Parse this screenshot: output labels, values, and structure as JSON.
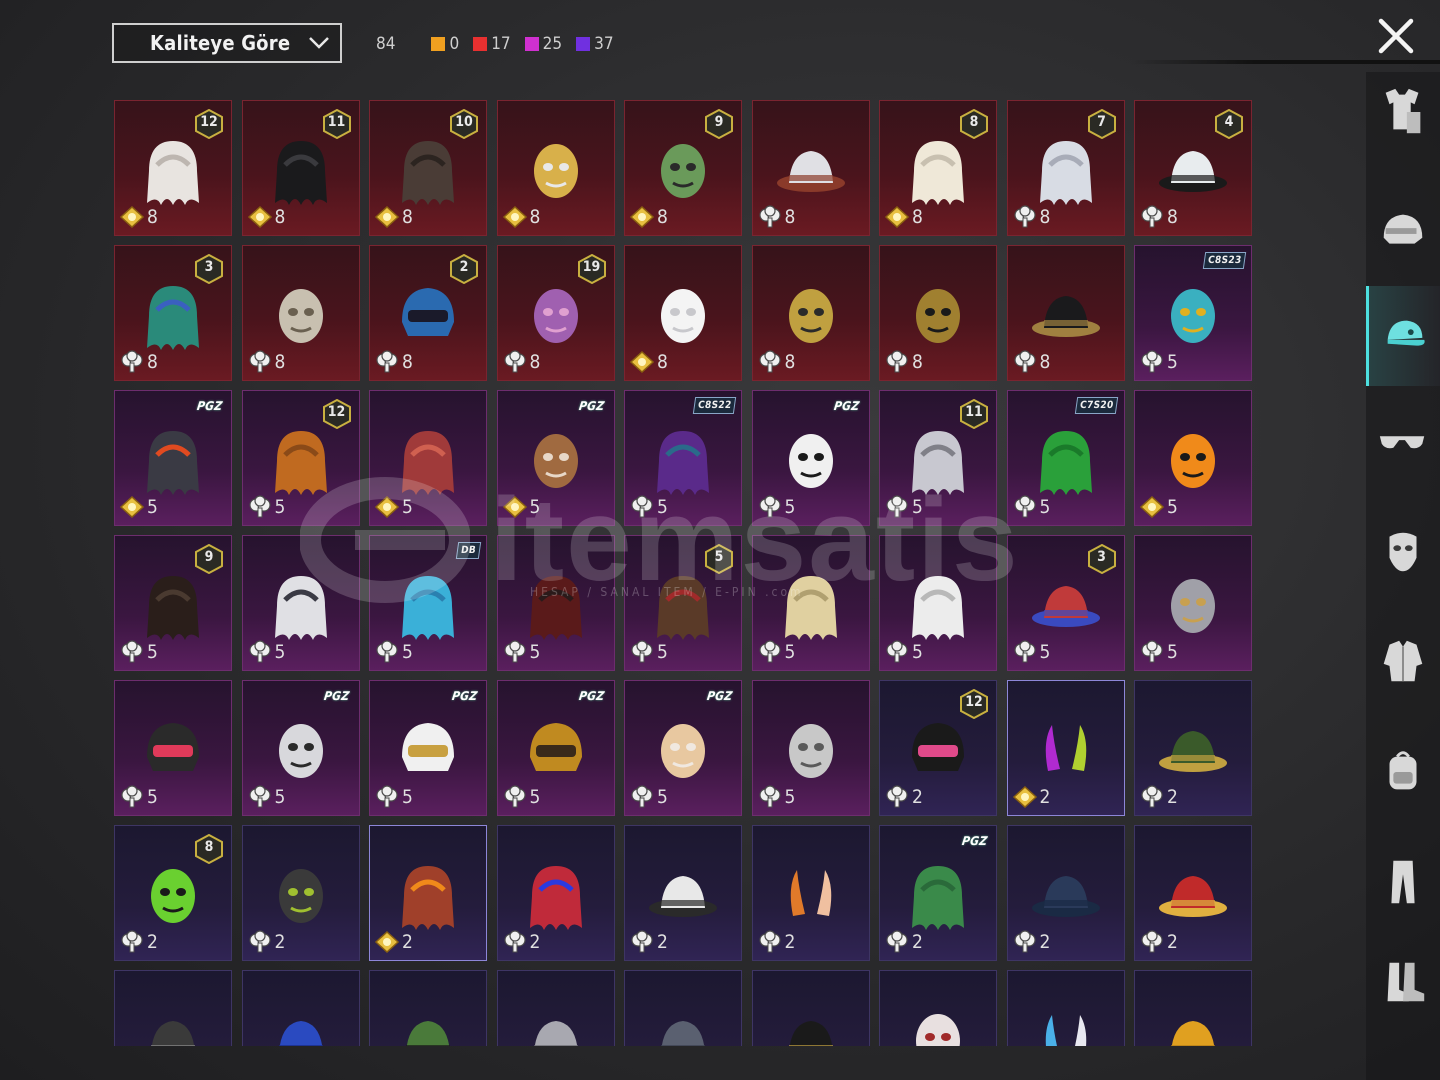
{
  "sort": {
    "label": "Kaliteye Göre"
  },
  "counts": {
    "total": "84",
    "items": [
      {
        "color": "#f0a020",
        "value": "0"
      },
      {
        "color": "#e83030",
        "value": "17"
      },
      {
        "color": "#d030d0",
        "value": "25"
      },
      {
        "color": "#7030e0",
        "value": "37"
      }
    ]
  },
  "watermark": {
    "text": "itemsatis",
    "sub": "HESAP / SANAL ITEM / E-PIN .com"
  },
  "nav": [
    {
      "name": "outfit-icon"
    },
    {
      "name": "helmet-icon"
    },
    {
      "name": "cap-icon",
      "active": true
    },
    {
      "name": "glasses-icon"
    },
    {
      "name": "mask-icon"
    },
    {
      "name": "jacket-icon"
    },
    {
      "name": "backpack-icon"
    },
    {
      "name": "pants-icon"
    },
    {
      "name": "boots-icon"
    }
  ],
  "items": [
    {
      "bg": "red",
      "level": "12",
      "qty": "8",
      "qicon": "gold",
      "art": "white-hair-bow",
      "c1": "#e8e4e0",
      "c2": "#bdb6b0"
    },
    {
      "bg": "red",
      "level": "11",
      "qty": "8",
      "qicon": "gold",
      "art": "black-hair",
      "c1": "#1a1a1c",
      "c2": "#3a3a3e"
    },
    {
      "bg": "red",
      "level": "10",
      "qty": "8",
      "qicon": "gold",
      "art": "dark-long-hair",
      "c1": "#4a3c36",
      "c2": "#2c2420"
    },
    {
      "bg": "red",
      "level": "",
      "qty": "8",
      "qicon": "gold",
      "art": "skull-mask-blonde",
      "c1": "#d8b04a",
      "c2": "#e8e8e8"
    },
    {
      "bg": "red",
      "level": "9",
      "qty": "8",
      "qicon": "gold",
      "art": "green-zombie-head",
      "c1": "#6a9a5a",
      "c2": "#2a2a2a"
    },
    {
      "bg": "red",
      "level": "",
      "qty": "8",
      "qicon": "silver",
      "art": "cowboy-hat-white",
      "c1": "#e0e0e4",
      "c2": "#8a3a2a"
    },
    {
      "bg": "red",
      "level": "8",
      "qty": "8",
      "qicon": "gold",
      "art": "platinum-bob-hair",
      "c1": "#efe8d8",
      "c2": "#c8c0b0"
    },
    {
      "bg": "red",
      "level": "7",
      "qty": "8",
      "qicon": "silver",
      "art": "silver-long-hair",
      "c1": "#d8dce4",
      "c2": "#a8acb8"
    },
    {
      "bg": "red",
      "level": "4",
      "qty": "8",
      "qicon": "silver",
      "art": "snowman-top-hat",
      "c1": "#e8ecee",
      "c2": "#1a1a1a"
    },
    {
      "bg": "red",
      "level": "3",
      "qty": "8",
      "qicon": "silver",
      "art": "joker-green-hair",
      "c1": "#2a8a7a",
      "c2": "#3a60c0"
    },
    {
      "bg": "red",
      "level": "",
      "qty": "8",
      "qicon": "silver",
      "art": "anubis-mask",
      "c1": "#c8c0b0",
      "c2": "#6a6050"
    },
    {
      "bg": "red",
      "level": "2",
      "qty": "8",
      "qicon": "silver",
      "art": "blue-mech-helmet",
      "c1": "#2a6ab0",
      "c2": "#1a1a2a"
    },
    {
      "bg": "red",
      "level": "19",
      "qty": "8",
      "qicon": "silver",
      "art": "purple-demon-mask",
      "c1": "#a060b0",
      "c2": "#e0a0d0"
    },
    {
      "bg": "red",
      "level": "",
      "qty": "8",
      "qicon": "gold",
      "art": "ghost-sheet",
      "c1": "#f4f4f4",
      "c2": "#c8c8cc"
    },
    {
      "bg": "red",
      "level": "",
      "qty": "8",
      "qicon": "silver",
      "art": "pharaoh-headdress",
      "c1": "#c0a040",
      "c2": "#2a2a2a"
    },
    {
      "bg": "red",
      "level": "",
      "qty": "8",
      "qicon": "silver",
      "art": "pharaoh-headdress-dark",
      "c1": "#a08030",
      "c2": "#1a1a1a"
    },
    {
      "bg": "red",
      "level": "",
      "qty": "8",
      "qicon": "silver",
      "art": "pirate-tricorn",
      "c1": "#1a1a1c",
      "c2": "#a08040"
    },
    {
      "bg": "purple",
      "level": "",
      "tag": "C8S23",
      "qty": "5",
      "qicon": "silver",
      "art": "cat-ear-headphones",
      "c1": "#3ab0c0",
      "c2": "#e0b020"
    },
    {
      "bg": "purple",
      "level": "",
      "tag": "PGZ",
      "qty": "5",
      "qicon": "gold",
      "art": "bandana-goggles",
      "c1": "#3a3a44",
      "c2": "#e04a20"
    },
    {
      "bg": "purple",
      "level": "12",
      "qty": "5",
      "qicon": "silver",
      "art": "orange-twin-tails",
      "c1": "#c06a20",
      "c2": "#8a4a18"
    },
    {
      "bg": "purple",
      "level": "",
      "qty": "5",
      "qicon": "gold",
      "art": "red-spiky-hair",
      "c1": "#a03a3a",
      "c2": "#d06050"
    },
    {
      "bg": "purple",
      "level": "",
      "tag": "PGZ",
      "qty": "5",
      "qicon": "gold",
      "art": "cow-mask",
      "c1": "#a06a40",
      "c2": "#e8d8c8"
    },
    {
      "bg": "purple",
      "level": "",
      "tag": "C8S22",
      "qty": "5",
      "qicon": "silver",
      "art": "purple-bob-hair",
      "c1": "#5a2a8a",
      "c2": "#2a6a8a"
    },
    {
      "bg": "purple",
      "level": "",
      "tag": "PGZ",
      "qty": "5",
      "qicon": "silver",
      "art": "panda-mask",
      "c1": "#f0f0f0",
      "c2": "#1a1a1a"
    },
    {
      "bg": "purple",
      "level": "11",
      "qty": "5",
      "qicon": "silver",
      "art": "veiled-hair",
      "c1": "#c8c8d0",
      "c2": "#808088"
    },
    {
      "bg": "purple",
      "level": "",
      "tag": "C7S20",
      "qty": "5",
      "qicon": "silver",
      "art": "green-hair",
      "c1": "#2aa03a",
      "c2": "#1a7a2a"
    },
    {
      "bg": "purple",
      "level": "",
      "qty": "5",
      "qicon": "gold",
      "art": "pumpkin-head",
      "c1": "#f08a1a",
      "c2": "#1a1a1a"
    },
    {
      "bg": "purple",
      "level": "9",
      "qty": "5",
      "qicon": "silver",
      "art": "dark-long-hair-2",
      "c1": "#2a1e1a",
      "c2": "#4a3a30"
    },
    {
      "bg": "purple",
      "level": "",
      "qty": "5",
      "qicon": "silver",
      "art": "witch-white-hair",
      "c1": "#e0e0e4",
      "c2": "#3a3a44"
    },
    {
      "bg": "purple",
      "level": "",
      "tag": "DB",
      "qty": "5",
      "qicon": "silver",
      "art": "blue-spiky-hair",
      "c1": "#3ab0d8",
      "c2": "#2a80b0"
    },
    {
      "bg": "purple",
      "level": "",
      "qty": "5",
      "qicon": "silver",
      "art": "red-black-hair",
      "c1": "#5a1a1a",
      "c2": "#2a1a1a"
    },
    {
      "bg": "purple",
      "level": "5",
      "qty": "5",
      "qicon": "silver",
      "art": "brown-twin-tails",
      "c1": "#5a3a28",
      "c2": "#a02a2a"
    },
    {
      "bg": "purple",
      "level": "",
      "qty": "5",
      "qicon": "silver",
      "art": "blonde-long-hair",
      "c1": "#e0d0a0",
      "c2": "#b0a070"
    },
    {
      "bg": "purple",
      "level": "",
      "qty": "5",
      "qicon": "silver",
      "art": "white-braid",
      "c1": "#ececec",
      "c2": "#b8b8b8"
    },
    {
      "bg": "purple",
      "level": "3",
      "qty": "5",
      "qicon": "silver",
      "art": "jester-hat",
      "c1": "#c03a3a",
      "c2": "#3a4ac0"
    },
    {
      "bg": "purple",
      "level": "",
      "qty": "5",
      "qicon": "silver",
      "art": "feathered-mask",
      "c1": "#a0a0a8",
      "c2": "#c8a050"
    },
    {
      "bg": "purple",
      "level": "",
      "qty": "5",
      "qicon": "silver",
      "art": "punk-helmet",
      "c1": "#2a2a2a",
      "c2": "#e03a5a"
    },
    {
      "bg": "purple",
      "level": "",
      "tag": "PGZ",
      "qty": "5",
      "qicon": "silver",
      "art": "bunny-mask",
      "c1": "#d8d8dc",
      "c2": "#2a2a2a"
    },
    {
      "bg": "purple",
      "level": "",
      "tag": "PGZ",
      "qty": "5",
      "qicon": "silver",
      "art": "gold-helmet-white-hair",
      "c1": "#f0f0f0",
      "c2": "#c8a040"
    },
    {
      "bg": "purple",
      "level": "",
      "tag": "PGZ",
      "qty": "5",
      "qicon": "silver",
      "art": "gold-moto-helmet",
      "c1": "#c08a20",
      "c2": "#3a2a1a"
    },
    {
      "bg": "purple",
      "level": "",
      "tag": "PGZ",
      "qty": "5",
      "qicon": "silver",
      "art": "cat-mask",
      "c1": "#e8c8a0",
      "c2": "#f0e8e0"
    },
    {
      "bg": "purple",
      "level": "",
      "qty": "5",
      "qicon": "silver",
      "art": "lion-mask",
      "c1": "#c8c8c8",
      "c2": "#5a5a5a"
    },
    {
      "bg": "blue",
      "level": "12",
      "qty": "2",
      "qicon": "silver",
      "art": "bunny-ear-helmet",
      "c1": "#1a1a1a",
      "c2": "#e04a8a"
    },
    {
      "bg": "blue",
      "level": "",
      "qty": "2",
      "qicon": "gold",
      "art": "devil-horns",
      "c1": "#b02ad0",
      "c2": "#b0d030",
      "selected": true
    },
    {
      "bg": "blue",
      "level": "",
      "qty": "2",
      "qicon": "silver",
      "art": "officer-caps",
      "c1": "#3a5a2a",
      "c2": "#c0a040"
    },
    {
      "bg": "blue",
      "level": "8",
      "qty": "2",
      "qicon": "silver",
      "art": "green-skull-hood",
      "c1": "#6ad030",
      "c2": "#1a1a1a"
    },
    {
      "bg": "blue",
      "level": "",
      "qty": "2",
      "qicon": "silver",
      "art": "gas-mask-helmet",
      "c1": "#3a3a3a",
      "c2": "#a0c030"
    },
    {
      "bg": "blue",
      "level": "",
      "qty": "2",
      "qicon": "gold",
      "art": "goggles-red-hair",
      "c1": "#a0402a",
      "c2": "#f08a1a",
      "selected": true
    },
    {
      "bg": "blue",
      "level": "",
      "qty": "2",
      "qicon": "silver",
      "art": "red-pigtails-bow",
      "c1": "#c02a3a",
      "c2": "#2a3ae0"
    },
    {
      "bg": "blue",
      "level": "",
      "qty": "2",
      "qicon": "silver",
      "art": "white-sun-hat",
      "c1": "#e8e8e8",
      "c2": "#2a2a2a"
    },
    {
      "bg": "blue",
      "level": "",
      "qty": "2",
      "qicon": "silver",
      "art": "cat-ears-orange",
      "c1": "#e07a2a",
      "c2": "#f0c0a0"
    },
    {
      "bg": "blue",
      "level": "",
      "tag": "PGZ",
      "qty": "2",
      "qicon": "silver",
      "art": "green-bob-hair",
      "c1": "#3a8a4a",
      "c2": "#2a6a3a"
    },
    {
      "bg": "blue",
      "level": "",
      "qty": "2",
      "qicon": "silver",
      "art": "navy-beanie",
      "c1": "#2a3a5a",
      "c2": "#1a2a44"
    },
    {
      "bg": "blue",
      "level": "",
      "qty": "2",
      "qicon": "silver",
      "art": "red-gold-cap",
      "c1": "#c02a2a",
      "c2": "#e0b040"
    },
    {
      "bg": "blue",
      "level": "",
      "qty": "",
      "qicon": "",
      "art": "witch-hat",
      "c1": "#3a3a3a",
      "c2": "#8a8a8a"
    },
    {
      "bg": "blue",
      "level": "",
      "qty": "",
      "qicon": "",
      "art": "blue-cap",
      "c1": "#2a4ac0",
      "c2": "#1a2a80"
    },
    {
      "bg": "blue",
      "level": "",
      "qty": "",
      "qicon": "",
      "art": "green-cap",
      "c1": "#4a7a3a",
      "c2": "#1a1a1a"
    },
    {
      "bg": "blue",
      "level": "",
      "qty": "",
      "qicon": "",
      "art": "grey-hat",
      "c1": "#a8a8b0",
      "c2": "#6a6a70"
    },
    {
      "bg": "blue",
      "level": "",
      "qty": "",
      "qicon": "",
      "art": "grey-beanie",
      "c1": "#5a6070",
      "c2": "#3a4050"
    },
    {
      "bg": "blue",
      "level": "",
      "qty": "",
      "qicon": "",
      "art": "black-top-hat",
      "c1": "#1a1a1a",
      "c2": "#c0a040"
    },
    {
      "bg": "blue",
      "level": "",
      "qty": "",
      "qicon": "",
      "art": "clown-mask",
      "c1": "#e8e0e0",
      "c2": "#a02a2a"
    },
    {
      "bg": "blue",
      "level": "",
      "qty": "",
      "qicon": "",
      "art": "blue-bunny-ears",
      "c1": "#4ab0e8",
      "c2": "#e8e8f0"
    },
    {
      "bg": "blue",
      "level": "",
      "qty": "",
      "qicon": "",
      "art": "yellow-bucket-hat",
      "c1": "#e0a020",
      "c2": "#b07a18"
    }
  ]
}
